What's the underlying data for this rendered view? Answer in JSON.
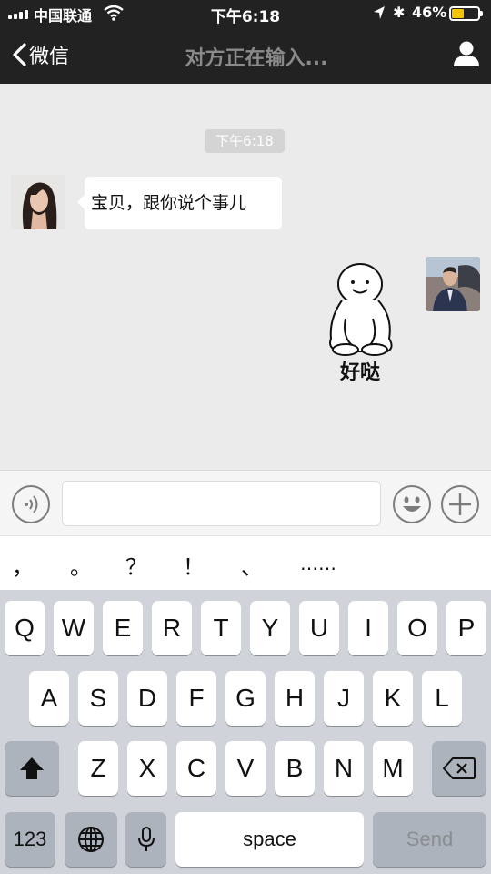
{
  "status_bar": {
    "carrier": "中国联通",
    "time": "下午6:18",
    "battery_pct": "46%",
    "battery_level": 0.46,
    "icons": [
      "signal-icon",
      "wifi-icon",
      "location-icon",
      "bluetooth-icon",
      "battery-icon"
    ]
  },
  "nav": {
    "back_label": "微信",
    "title": "对方正在输入...",
    "icons": [
      "chevron-left-icon",
      "profile-icon"
    ]
  },
  "chat": {
    "timestamp": "下午6:18",
    "messages": [
      {
        "side": "left",
        "type": "text",
        "text": "宝贝，跟你说个事儿"
      },
      {
        "side": "right",
        "type": "sticker",
        "sticker_text": "好哒"
      }
    ]
  },
  "input_bar": {
    "value": "",
    "icons": [
      "voice-icon",
      "emoji-icon",
      "plus-icon"
    ]
  },
  "punctuation": [
    "，",
    "。",
    "？",
    "！",
    "、",
    "……"
  ],
  "keyboard": {
    "row1": [
      "Q",
      "W",
      "E",
      "R",
      "T",
      "Y",
      "U",
      "I",
      "O",
      "P"
    ],
    "row2": [
      "A",
      "S",
      "D",
      "F",
      "G",
      "H",
      "J",
      "K",
      "L"
    ],
    "row3": [
      "Z",
      "X",
      "C",
      "V",
      "B",
      "N",
      "M"
    ],
    "numbers_label": "123",
    "space_label": "space",
    "send_label": "Send",
    "icons": [
      "shift-icon",
      "backspace-icon",
      "globe-icon",
      "microphone-icon"
    ]
  },
  "colors": {
    "topbar": "#222222",
    "chat_bg": "#ebebeb",
    "battery": "#f5c400",
    "keyboard_bg": "#d0d3d9"
  }
}
